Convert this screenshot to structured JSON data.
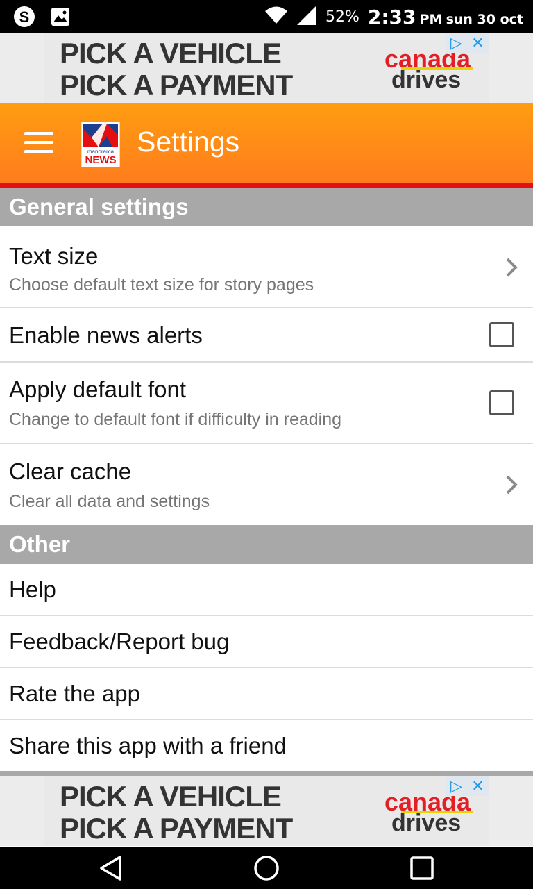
{
  "status_bar": {
    "icons_left": [
      "skype-icon",
      "image-icon"
    ],
    "icons_right": [
      "wifi-icon",
      "signal-icon"
    ],
    "battery": "52%",
    "time": "2:33",
    "ampm": "PM",
    "date": "sun 30 oct"
  },
  "ad": {
    "line1": "PICK A VEHICLE",
    "line2": "PICK A PAYMENT",
    "brand_line1": "canada",
    "brand_line2": "drives",
    "adchoices_icon": "▷",
    "close_icon": "✕",
    "brand_color": "#e31e24"
  },
  "app_bar": {
    "title": "Settings",
    "logo_text_top": "manorama",
    "logo_text_bottom": "NEWS",
    "color_top": "#ff9d10",
    "color_bottom": "#ff7c1d",
    "accent_line": "#e30f10"
  },
  "sections": {
    "general": {
      "header": "General settings",
      "items": [
        {
          "title": "Text size",
          "subtitle": "Choose default text size for story pages",
          "control": "chevron"
        },
        {
          "title": "Enable news alerts",
          "subtitle": "",
          "control": "checkbox",
          "checked": false
        },
        {
          "title": "Apply default font",
          "subtitle": "Change to default font if difficulty in reading",
          "control": "checkbox",
          "checked": false
        },
        {
          "title": "Clear cache",
          "subtitle": "Clear all data and settings",
          "control": "chevron"
        }
      ]
    },
    "other": {
      "header": "Other",
      "items": [
        {
          "title": "Help"
        },
        {
          "title": "Feedback/Report bug"
        },
        {
          "title": "Rate the app"
        },
        {
          "title": "Share this app with a friend"
        }
      ]
    }
  },
  "nav_bar": {
    "buttons": [
      "back-icon",
      "home-icon",
      "recents-icon"
    ]
  }
}
